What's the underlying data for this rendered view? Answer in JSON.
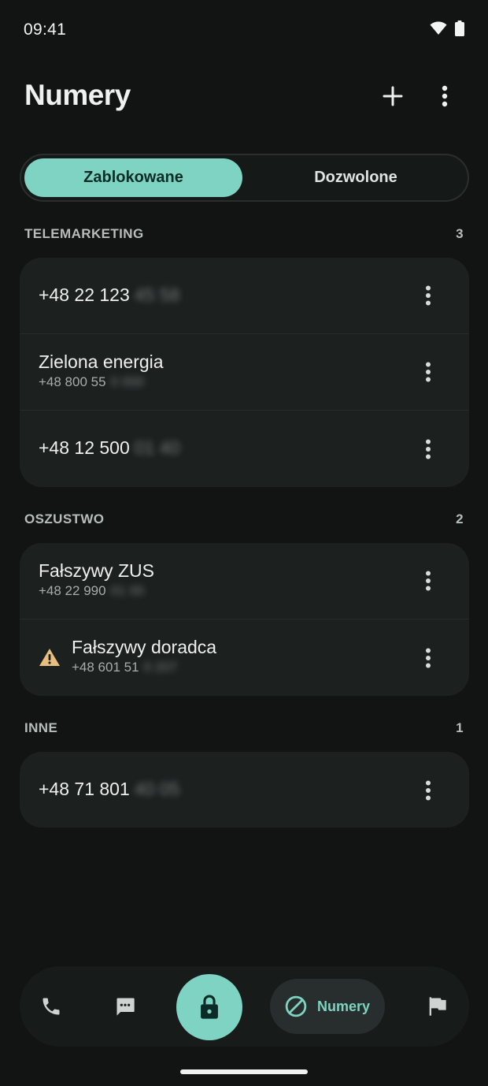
{
  "status": {
    "time": "09:41"
  },
  "header": {
    "title": "Numery"
  },
  "tabs": [
    {
      "label": "Zablokowane",
      "active": true
    },
    {
      "label": "Dozwolone",
      "active": false
    }
  ],
  "sections": [
    {
      "title": "TELEMARKETING",
      "count": "3",
      "items": [
        {
          "primary": "+48 22 123",
          "primary_hidden": "45 58"
        },
        {
          "primary": "Zielona energia",
          "secondary": "+48 800 55",
          "secondary_hidden": "0 000"
        },
        {
          "primary": "+48 12 500",
          "primary_hidden": "01 40"
        }
      ]
    },
    {
      "title": "OSZUSTWO",
      "count": "2",
      "items": [
        {
          "primary": "Fałszywy ZUS",
          "secondary": "+48 22 990",
          "secondary_hidden": "01 00"
        },
        {
          "primary": "Fałszywy doradca",
          "secondary": "+48 601 51",
          "secondary_hidden": "0 207",
          "icon": "warning-icon"
        }
      ]
    },
    {
      "title": "INNE",
      "count": "1",
      "items": [
        {
          "primary": "+48 71 801",
          "primary_hidden": "40 05"
        }
      ]
    }
  ],
  "nav": {
    "active_label": "Numery"
  },
  "colors": {
    "accent": "#7ed3c2",
    "warning": "#e7c080",
    "background": "#121414",
    "card": "#1c2120"
  }
}
